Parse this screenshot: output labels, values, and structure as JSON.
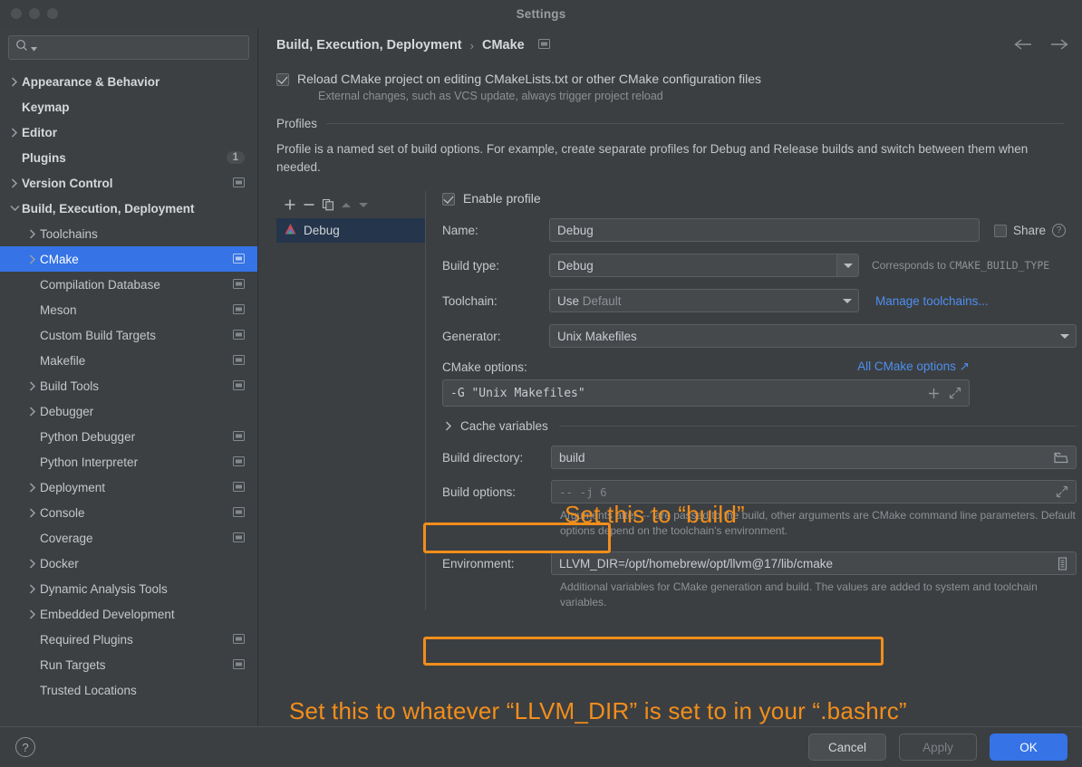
{
  "window": {
    "title": "Settings"
  },
  "sidebar": {
    "search": {
      "placeholder": "",
      "value": ""
    },
    "items": [
      {
        "label": "Appearance & Behavior",
        "chevron": "right",
        "level": 0,
        "bold": true,
        "badge": null,
        "proj": false
      },
      {
        "label": "Keymap",
        "chevron": "none",
        "level": 0,
        "bold": true,
        "badge": null,
        "proj": false
      },
      {
        "label": "Editor",
        "chevron": "right",
        "level": 0,
        "bold": true,
        "badge": null,
        "proj": false
      },
      {
        "label": "Plugins",
        "chevron": "none",
        "level": 0,
        "bold": true,
        "badge": "1",
        "proj": false
      },
      {
        "label": "Version Control",
        "chevron": "right",
        "level": 0,
        "bold": true,
        "badge": null,
        "proj": true
      },
      {
        "label": "Build, Execution, Deployment",
        "chevron": "down",
        "level": 0,
        "bold": true,
        "badge": null,
        "proj": false
      },
      {
        "label": "Toolchains",
        "chevron": "right",
        "level": 1,
        "bold": false,
        "badge": null,
        "proj": false
      },
      {
        "label": "CMake",
        "chevron": "right",
        "level": 1,
        "bold": false,
        "badge": null,
        "proj": true,
        "selected": true
      },
      {
        "label": "Compilation Database",
        "chevron": "none",
        "level": 1,
        "bold": false,
        "badge": null,
        "proj": true
      },
      {
        "label": "Meson",
        "chevron": "none",
        "level": 1,
        "bold": false,
        "badge": null,
        "proj": true
      },
      {
        "label": "Custom Build Targets",
        "chevron": "none",
        "level": 1,
        "bold": false,
        "badge": null,
        "proj": true
      },
      {
        "label": "Makefile",
        "chevron": "none",
        "level": 1,
        "bold": false,
        "badge": null,
        "proj": true
      },
      {
        "label": "Build Tools",
        "chevron": "right",
        "level": 1,
        "bold": false,
        "badge": null,
        "proj": true
      },
      {
        "label": "Debugger",
        "chevron": "right",
        "level": 1,
        "bold": false,
        "badge": null,
        "proj": false
      },
      {
        "label": "Python Debugger",
        "chevron": "none",
        "level": 1,
        "bold": false,
        "badge": null,
        "proj": true
      },
      {
        "label": "Python Interpreter",
        "chevron": "none",
        "level": 1,
        "bold": false,
        "badge": null,
        "proj": true
      },
      {
        "label": "Deployment",
        "chevron": "right",
        "level": 1,
        "bold": false,
        "badge": null,
        "proj": true
      },
      {
        "label": "Console",
        "chevron": "right",
        "level": 1,
        "bold": false,
        "badge": null,
        "proj": true
      },
      {
        "label": "Coverage",
        "chevron": "none",
        "level": 1,
        "bold": false,
        "badge": null,
        "proj": true
      },
      {
        "label": "Docker",
        "chevron": "right",
        "level": 1,
        "bold": false,
        "badge": null,
        "proj": false
      },
      {
        "label": "Dynamic Analysis Tools",
        "chevron": "right",
        "level": 1,
        "bold": false,
        "badge": null,
        "proj": false
      },
      {
        "label": "Embedded Development",
        "chevron": "right",
        "level": 1,
        "bold": false,
        "badge": null,
        "proj": false
      },
      {
        "label": "Required Plugins",
        "chevron": "none",
        "level": 1,
        "bold": false,
        "badge": null,
        "proj": true
      },
      {
        "label": "Run Targets",
        "chevron": "none",
        "level": 1,
        "bold": false,
        "badge": null,
        "proj": true
      },
      {
        "label": "Trusted Locations",
        "chevron": "none",
        "level": 1,
        "bold": false,
        "badge": null,
        "proj": false
      }
    ]
  },
  "breadcrumb": {
    "parent": "Build, Execution, Deployment",
    "separator": "›",
    "current": "CMake"
  },
  "reload": {
    "checked": true,
    "label": "Reload CMake project on editing CMakeLists.txt or other CMake configuration files",
    "sub": "External changes, such as VCS update, always trigger project reload"
  },
  "profiles": {
    "section_title": "Profiles",
    "description": "Profile is a named set of build options. For example, create separate profiles for Debug and Release builds and switch between them when needed.",
    "toolbar": {
      "add": "+",
      "remove": "−",
      "copy": "copy",
      "up": "up",
      "down": "down"
    },
    "list": [
      {
        "name": "Debug",
        "selected": true
      }
    ]
  },
  "form": {
    "enable_profile": {
      "label": "Enable profile",
      "checked": true
    },
    "name": {
      "label": "Name:",
      "value": "Debug"
    },
    "share": {
      "label": "Share",
      "checked": false
    },
    "build_type": {
      "label": "Build type:",
      "value": "Debug",
      "hint_prefix": "Corresponds to ",
      "hint_mono": "CMAKE_BUILD_TYPE"
    },
    "toolchain": {
      "label": "Toolchain:",
      "value": "Use",
      "placeholder": "Default",
      "link": "Manage toolchains..."
    },
    "generator": {
      "label": "Generator:",
      "value": "Unix Makefiles"
    },
    "cmake_options": {
      "label": "CMake options:",
      "value": "-G \"Unix Makefiles\"",
      "link": "All CMake options ↗"
    },
    "cache_variables": {
      "label": "Cache variables"
    },
    "build_directory": {
      "label": "Build directory:",
      "value": "build"
    },
    "build_options": {
      "label": "Build options:",
      "value": "-- -j 6",
      "help": "Arguments after '--' are passed to the build, other arguments are CMake command line parameters. Default options depend on the toolchain's environment."
    },
    "environment": {
      "label": "Environment:",
      "value": "LLVM_DIR=/opt/homebrew/opt/llvm@17/lib/cmake",
      "help": "Additional variables for CMake generation and build. The values are added to system and toolchain variables."
    }
  },
  "annotations": {
    "color": "#f28e1c",
    "build_dir_note": "Set this to “build”",
    "env_note": "Set this to whatever “LLVM_DIR” is set to in your “.bashrc”"
  },
  "footer": {
    "help": "?",
    "cancel": "Cancel",
    "apply": "Apply",
    "ok": "OK"
  }
}
